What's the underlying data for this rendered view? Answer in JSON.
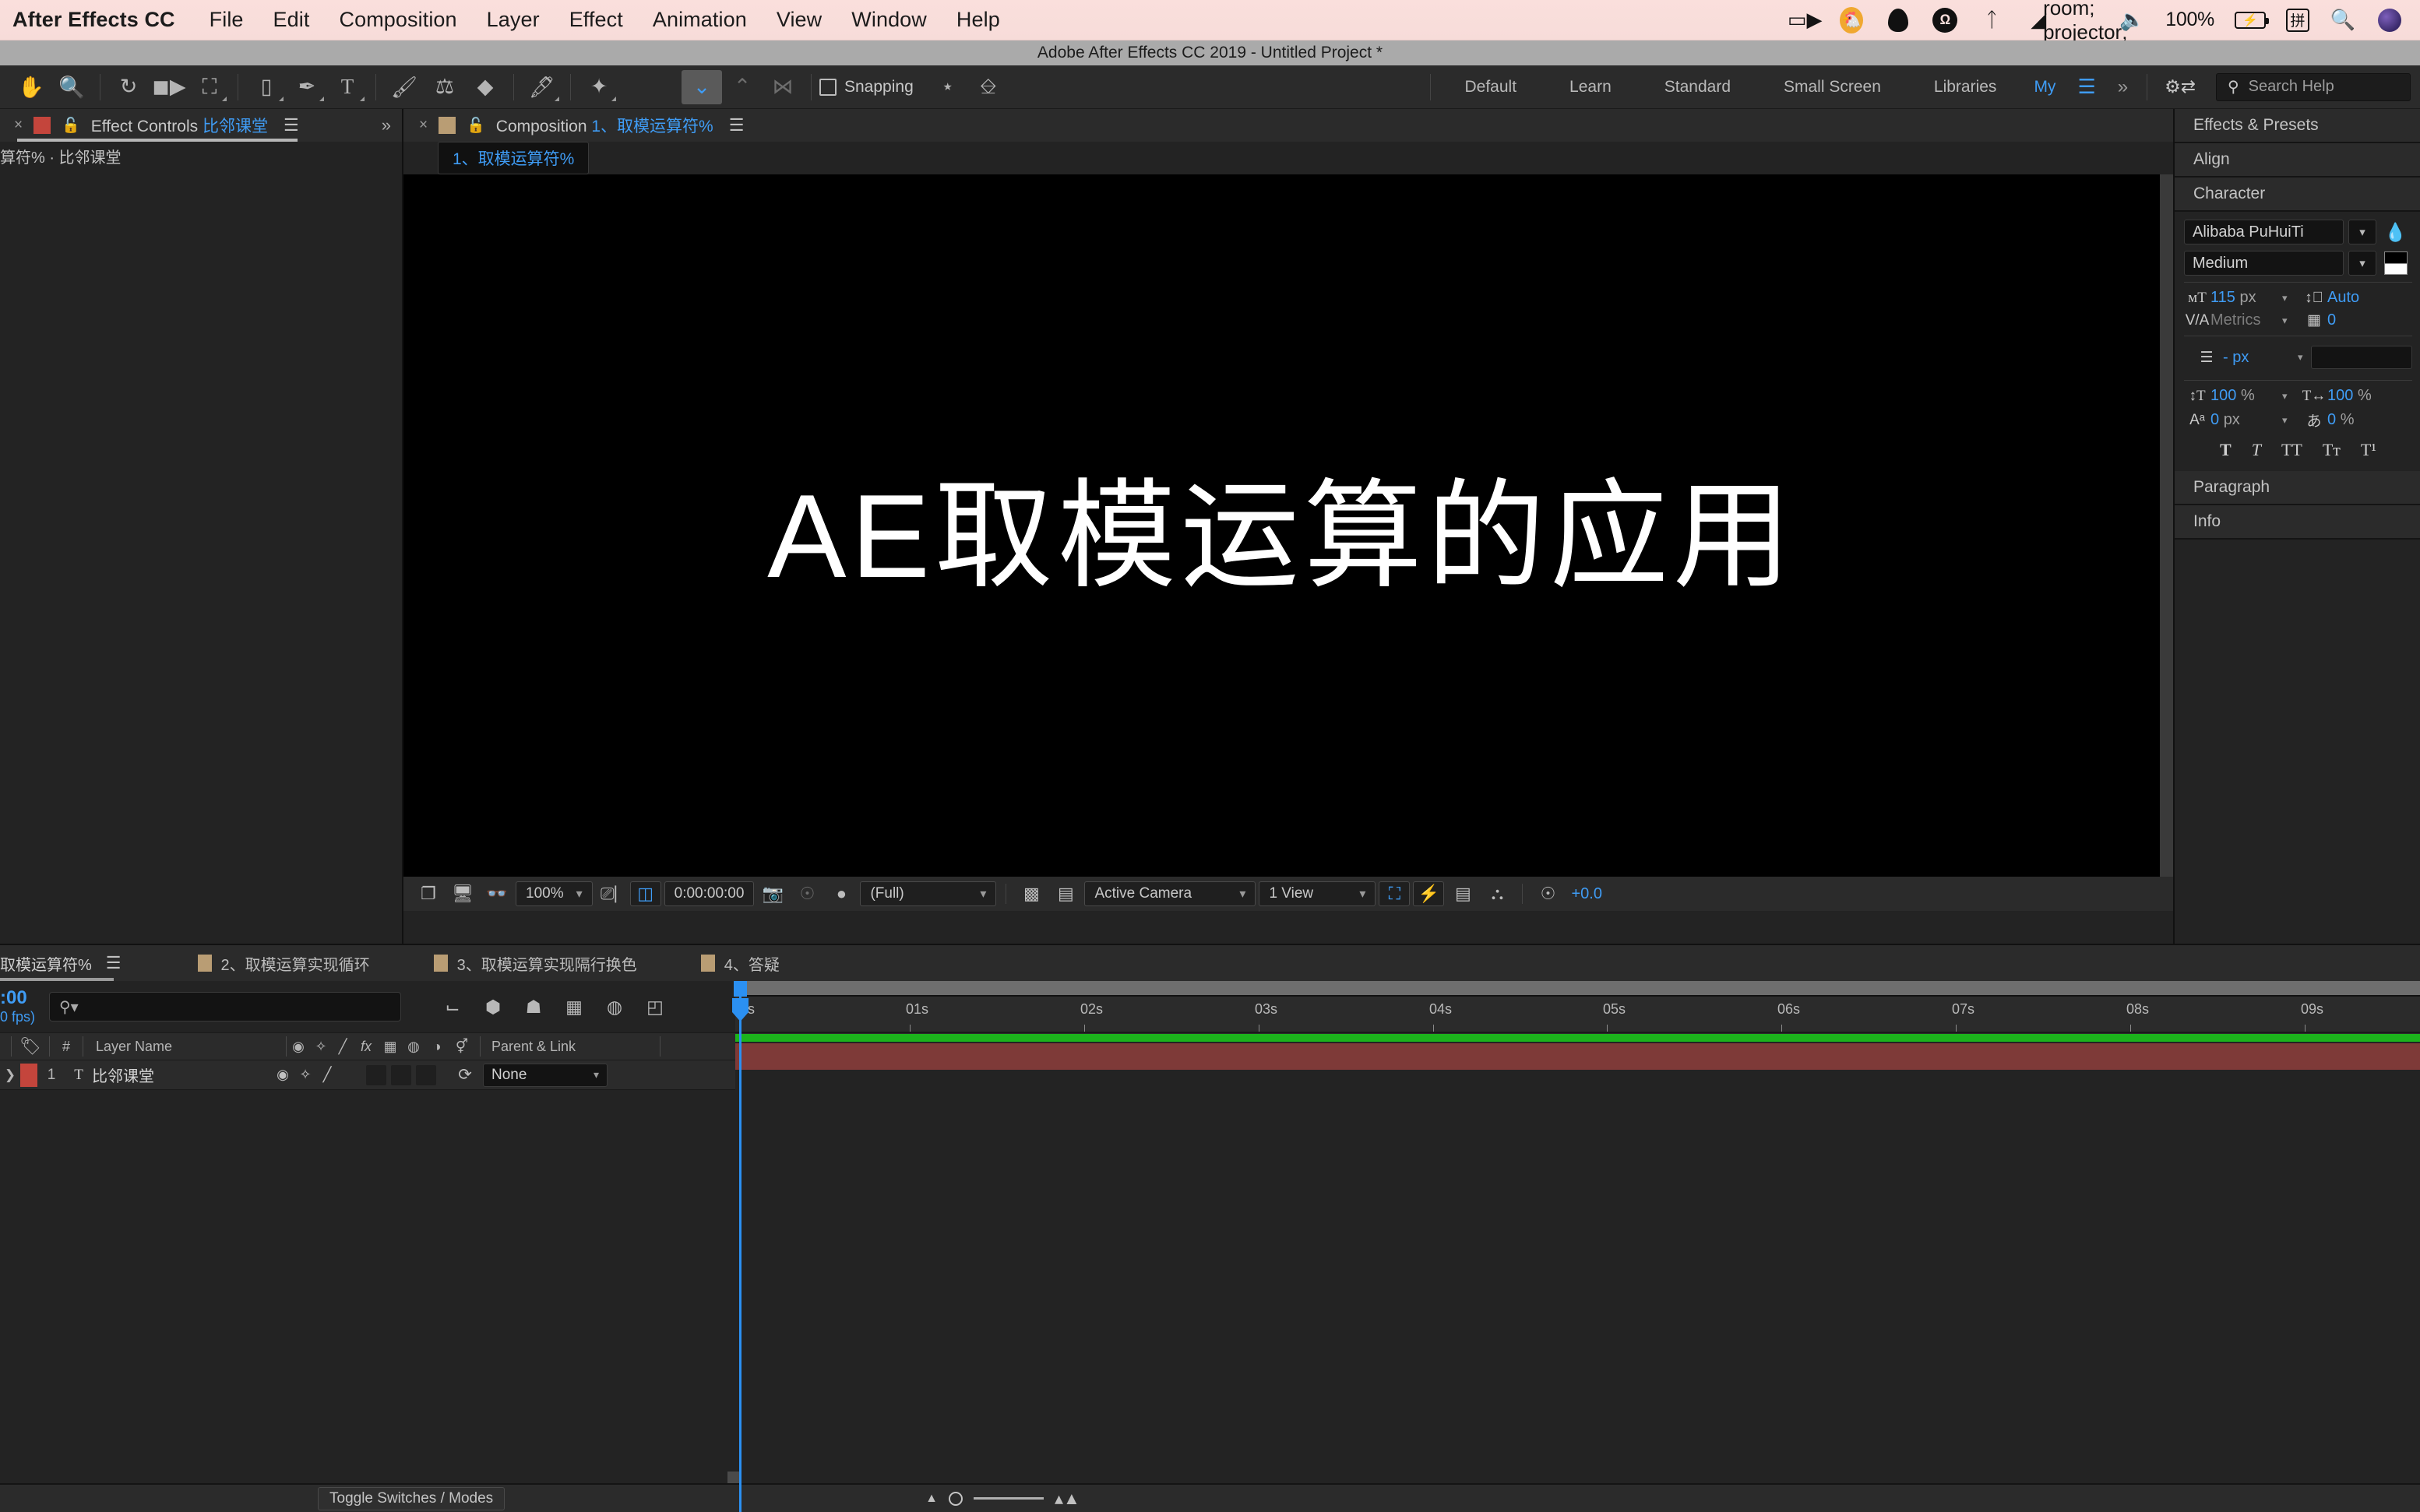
{
  "macos_menubar": {
    "app_name": "After Effects CC",
    "menus": [
      "File",
      "Edit",
      "Composition",
      "Layer",
      "Effect",
      "Animation",
      "View",
      "Window",
      "Help"
    ],
    "status_icons": [
      "screen-recording-icon",
      "rooster-icon",
      "qq-icon",
      "creative-cloud-icon",
      "bluetooth-icon",
      "wifi-icon",
      "airplay-icon",
      "volume-icon"
    ],
    "battery_percent": "100%",
    "battery_icon": "battery-charging-icon",
    "input_method": "拼",
    "search_icon": "spotlight-search-icon",
    "avatar": "user-avatar"
  },
  "titlebar": {
    "title": "Adobe After Effects CC 2019 - Untitled Project *"
  },
  "toolbar": {
    "tools": [
      {
        "name": "hand-tool-icon",
        "glyph": "✋"
      },
      {
        "name": "zoom-tool-icon",
        "glyph": "🔍"
      },
      {
        "name": "rotation-tool-icon",
        "glyph": "↻"
      },
      {
        "name": "camera-tool-icon",
        "glyph": "🎥"
      },
      {
        "name": "pan-behind-tool-icon",
        "glyph": "⛶"
      },
      {
        "name": "shape-tool-icon",
        "glyph": "▢"
      },
      {
        "name": "pen-tool-icon",
        "glyph": "✒"
      },
      {
        "name": "type-tool-icon",
        "glyph": "T"
      },
      {
        "name": "brush-tool-icon",
        "glyph": "🖌"
      },
      {
        "name": "clone-stamp-tool-icon",
        "glyph": "⚱"
      },
      {
        "name": "eraser-tool-icon",
        "glyph": "◆"
      },
      {
        "name": "roto-brush-tool-icon",
        "glyph": "🖋"
      },
      {
        "name": "puppet-pin-tool-icon",
        "glyph": "📌"
      }
    ],
    "puppet_tools": [
      {
        "name": "puppet-position-pin-icon",
        "glyph": "⋎",
        "active": true
      },
      {
        "name": "puppet-starch-pin-icon",
        "glyph": "⋏",
        "active": false
      },
      {
        "name": "puppet-overlap-pin-icon",
        "glyph": "⋈",
        "active": false
      }
    ],
    "snapping_label": "Snapping",
    "snapping_checked": false,
    "extra_icons": [
      {
        "name": "snap-align-icon",
        "glyph": "⌁"
      },
      {
        "name": "marquee-select-icon",
        "glyph": "⬚"
      }
    ],
    "workspaces": [
      "Default",
      "Learn",
      "Standard",
      "Small Screen",
      "Libraries"
    ],
    "workspace_my": "My",
    "workspace_menu_icon": "hamburger-menu-icon",
    "workspace_overflow_icon": "double-chevron-right-icon",
    "gear_switch_icon": "workspace-settings-icon",
    "search_help_placeholder": "Search Help",
    "search_icon": "search-icon"
  },
  "effect_controls": {
    "close_icon": "close-x-icon",
    "swatch_color": "#c4453c",
    "lock_icon": "lock-icon",
    "title_prefix": "Effect Controls ",
    "title_layer": "比邻课堂",
    "menu_icon": "panel-menu-icon",
    "overflow_icon": "double-chevron-right-icon",
    "subheader": "算符% · 比邻课堂"
  },
  "composition_panel": {
    "close_icon": "close-x-icon",
    "swatch_color": "#b99d74",
    "lock_icon": "lock-icon",
    "title_prefix": "Composition ",
    "title_comp": "1、取模运算符%",
    "menu_icon": "panel-menu-icon",
    "subtab_label": "1、取模运算符%",
    "canvas_text": "AE取模运算的应用",
    "viewer_toolbar": {
      "icons_left": [
        {
          "name": "always-preview-icon",
          "glyph": "▤"
        },
        {
          "name": "main-viewer-icon",
          "glyph": "🖵"
        },
        {
          "name": "3d-glasses-icon",
          "glyph": "👓"
        }
      ],
      "magnification": "100%",
      "resolution_icon": "choose-grid-guide-icon",
      "region-of-interest-icon": "region-of-interest-icon",
      "current_time": "0:00:00:00",
      "snapshot_icon": "take-snapshot-icon",
      "show_snapshot_icon": "show-snapshot-icon",
      "channels_icon": "show-channel-icon",
      "resolution": "(Full)",
      "toggle_transparency_icon": "toggle-transparency-grid-icon",
      "toggle_mask_icon": "toggle-mask-paths-icon",
      "camera": "Active Camera",
      "views": "1 View",
      "pixel_aspect_icon": "pixel-aspect-correction-icon",
      "fast_preview_icon": "fast-previews-icon",
      "timeline_icon": "timeline-icon",
      "flowchart_icon": "comp-flowchart-icon",
      "exposure_icon": "reset-exposure-icon",
      "exposure_value": "+0.0"
    }
  },
  "right_panel": {
    "sections": [
      "Effects & Presets",
      "Align",
      "Character",
      "Paragraph",
      "Info"
    ],
    "character": {
      "font_family": "Alibaba PuHuiTi",
      "font_style": "Medium",
      "eyedropper_icon": "eyedropper-icon",
      "fill_color": "#000000",
      "stroke_color": "#ffffff",
      "font_size_icon": "font-size-icon",
      "font_size": "115",
      "font_size_unit": "px",
      "leading_icon": "leading-icon",
      "leading": "Auto",
      "kerning_icon": "kerning-icon",
      "kerning": "Metrics",
      "tracking_icon": "tracking-icon",
      "tracking": "0",
      "stroke_width_icon": "stroke-width-icon",
      "stroke_width": "- px",
      "vscale_icon": "vertical-scale-icon",
      "vertical_scale": "100",
      "vertical_scale_unit": "%",
      "hscale_icon": "horizontal-scale-icon",
      "horizontal_scale": "100",
      "horizontal_scale_unit": "%",
      "baseline_icon": "baseline-shift-icon",
      "baseline_shift": "0",
      "baseline_unit": "px",
      "tsume_icon": "tsume-icon",
      "tsume": "0",
      "tsume_unit": "%",
      "style_buttons": [
        {
          "name": "faux-bold-button",
          "glyph": "T"
        },
        {
          "name": "faux-italic-button",
          "glyph": "T"
        },
        {
          "name": "all-caps-button",
          "glyph": "TT"
        },
        {
          "name": "small-caps-button",
          "glyph": "Tᴛ"
        },
        {
          "name": "superscript-button",
          "glyph": "T¹"
        }
      ]
    }
  },
  "timeline": {
    "tabs": [
      {
        "label": "取模运算符%",
        "active": true,
        "has_swatch": false,
        "has_menu": true
      },
      {
        "label": "2、取模运算实现循环",
        "active": false,
        "has_swatch": true
      },
      {
        "label": "3、取模运算实现隔行换色",
        "active": false,
        "has_swatch": true
      },
      {
        "label": "4、答疑",
        "active": false,
        "has_swatch": true
      }
    ],
    "menu_icon": "panel-menu-icon",
    "current_time": ":00",
    "fps_label": "0 fps)",
    "search_icon": "layer-search-icon",
    "search_value": "",
    "toolbar_icons": [
      {
        "name": "composition-mini-flowchart-icon",
        "glyph": "⌁"
      },
      {
        "name": "draft-3d-icon",
        "glyph": "⬨"
      },
      {
        "name": "hide-shy-layers-icon",
        "glyph": "☗"
      },
      {
        "name": "frame-blending-icon",
        "glyph": "▦"
      },
      {
        "name": "motion-blur-icon",
        "glyph": "◍"
      },
      {
        "name": "graph-editor-icon",
        "glyph": "◰"
      }
    ],
    "columns": {
      "tag_icon": "label-tag-icon",
      "number": "#",
      "layer_name": "Layer Name",
      "switch_icons": [
        {
          "name": "video-switch-icon",
          "glyph": "◉"
        },
        {
          "name": "audio-switch-icon",
          "glyph": "✧"
        },
        {
          "name": "solo-switch-icon",
          "glyph": "╲"
        },
        {
          "name": "fx-switch-icon",
          "glyph": "fx"
        },
        {
          "name": "frame-blend-icon",
          "glyph": "▤"
        },
        {
          "name": "motion-blur-icon",
          "glyph": "◍"
        },
        {
          "name": "adjustment-layer-icon",
          "glyph": "◑"
        },
        {
          "name": "3d-layer-icon",
          "glyph": "⬡"
        }
      ],
      "parent_and_link": "Parent & Link"
    },
    "layers": [
      {
        "expand_icon": "expand-triangle-icon",
        "color": "#c4453c",
        "number": "1",
        "type_icon": "T",
        "name": "比邻课堂",
        "parent": "None",
        "parent_pickwhip_icon": "pickwhip-icon"
      }
    ],
    "ruler_ticks": [
      "0s",
      "01s",
      "02s",
      "03s",
      "04s",
      "05s",
      "06s",
      "07s",
      "08s",
      "09s"
    ],
    "bar_colors": {
      "work_area": "#1cb31c",
      "layer_bar": "#7e3a38",
      "playhead": "#2b90f2"
    }
  },
  "bottom_bar": {
    "toggle_label": "Toggle Switches / Modes",
    "zoom_small_icon": "zoom-out-icon",
    "zoom_big_icon": "zoom-in-icon"
  }
}
